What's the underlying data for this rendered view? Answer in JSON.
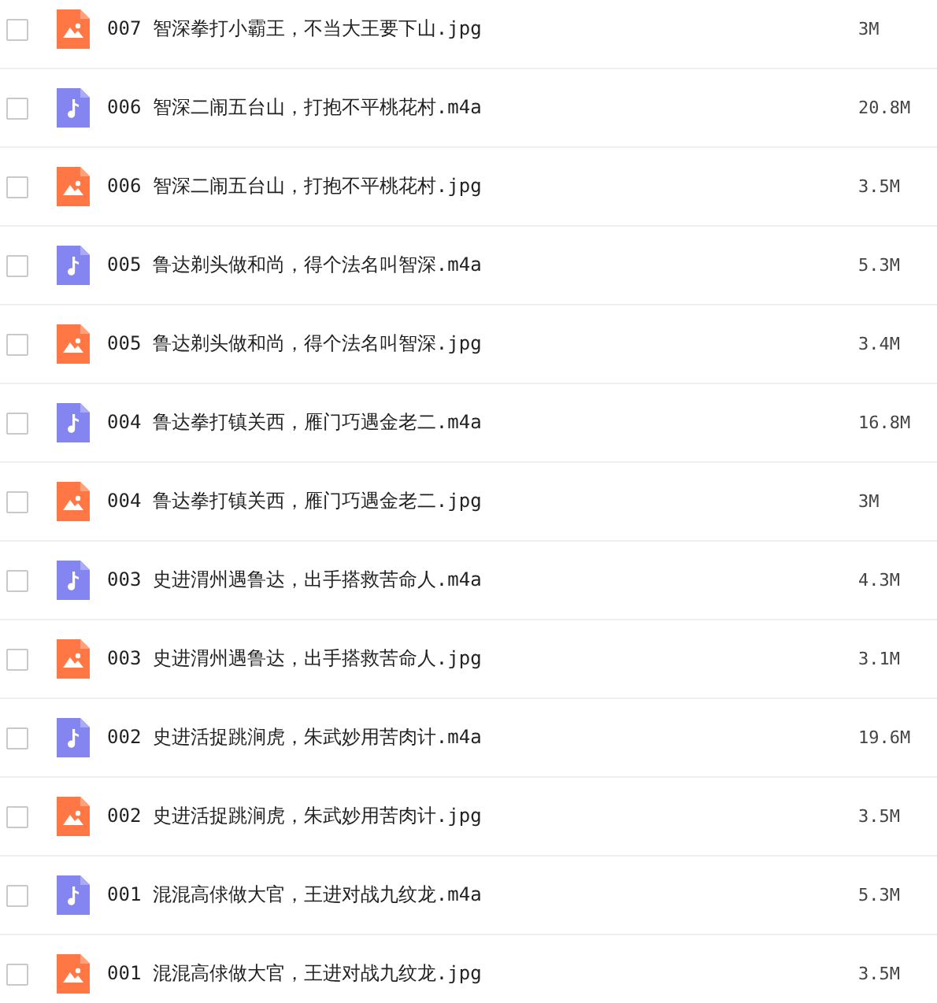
{
  "files": [
    {
      "kind": "image",
      "name": "007 智深拳打小霸王，不当大王要下山.jpg",
      "size": "3M",
      "checked": false
    },
    {
      "kind": "audio",
      "name": "006 智深二闹五台山，打抱不平桃花村.m4a",
      "size": "20.8M",
      "checked": false
    },
    {
      "kind": "image",
      "name": "006 智深二闹五台山，打抱不平桃花村.jpg",
      "size": "3.5M",
      "checked": false
    },
    {
      "kind": "audio",
      "name": "005 鲁达剃头做和尚，得个法名叫智深.m4a",
      "size": "5.3M",
      "checked": false
    },
    {
      "kind": "image",
      "name": "005 鲁达剃头做和尚，得个法名叫智深.jpg",
      "size": "3.4M",
      "checked": false
    },
    {
      "kind": "audio",
      "name": "004 鲁达拳打镇关西，雁门巧遇金老二.m4a",
      "size": "16.8M",
      "checked": false
    },
    {
      "kind": "image",
      "name": "004 鲁达拳打镇关西，雁门巧遇金老二.jpg",
      "size": "3M",
      "checked": false
    },
    {
      "kind": "audio",
      "name": "003 史进渭州遇鲁达，出手搭救苦命人.m4a",
      "size": "4.3M",
      "checked": false
    },
    {
      "kind": "image",
      "name": "003 史进渭州遇鲁达，出手搭救苦命人.jpg",
      "size": "3.1M",
      "checked": false
    },
    {
      "kind": "audio",
      "name": "002 史进活捉跳涧虎，朱武妙用苦肉计.m4a",
      "size": "19.6M",
      "checked": false
    },
    {
      "kind": "image",
      "name": "002 史进活捉跳涧虎，朱武妙用苦肉计.jpg",
      "size": "3.5M",
      "checked": false
    },
    {
      "kind": "audio",
      "name": "001 混混高俅做大官，王进对战九纹龙.m4a",
      "size": "5.3M",
      "checked": false
    },
    {
      "kind": "image",
      "name": "001 混混高俅做大官，王进对战九纹龙.jpg",
      "size": "3.5M",
      "checked": false
    }
  ]
}
